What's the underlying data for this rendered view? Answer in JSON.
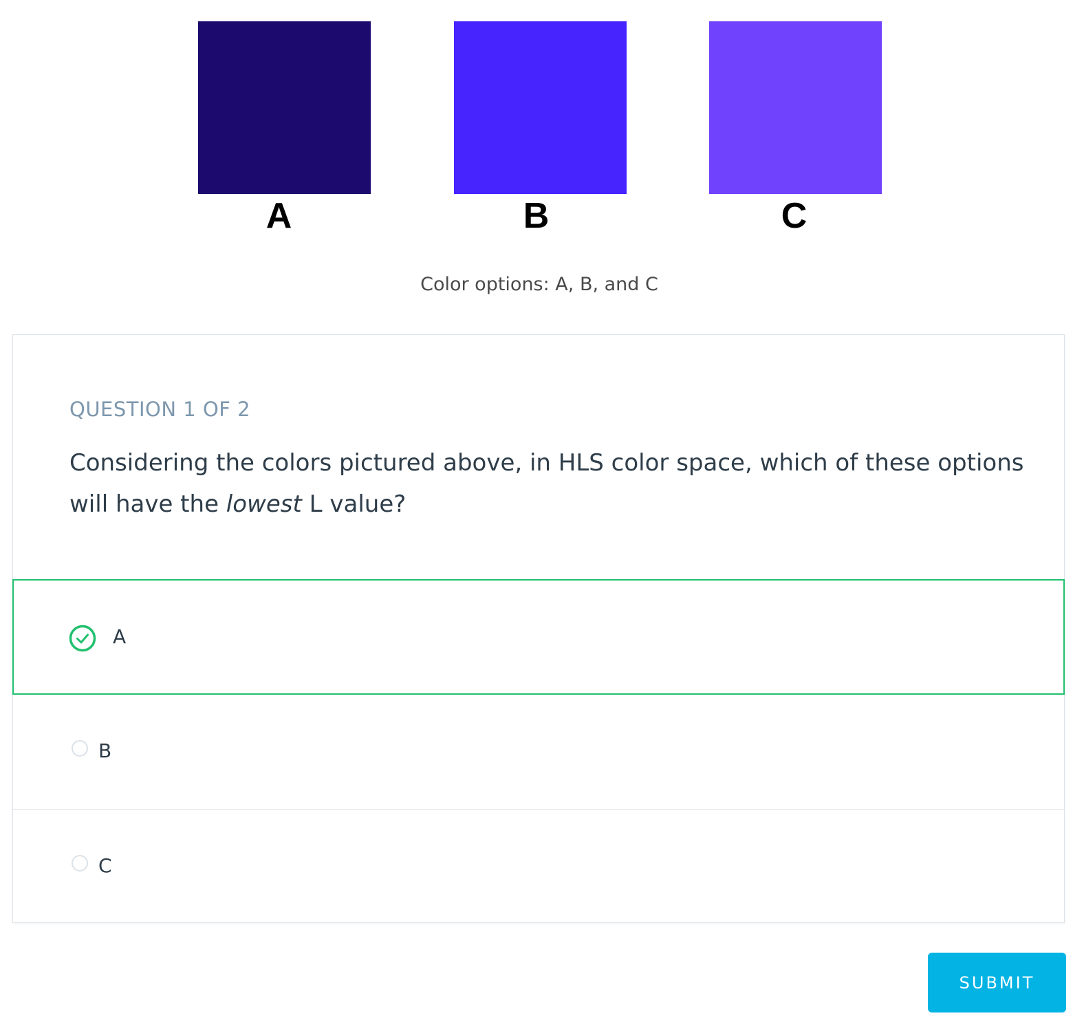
{
  "figure": {
    "swatches": [
      {
        "label": "A",
        "color": "#1d0a6e"
      },
      {
        "label": "B",
        "color": "#4723fe"
      },
      {
        "label": "C",
        "color": "#7142fd"
      }
    ],
    "caption": "Color options: A, B, and C"
  },
  "question": {
    "progress": "QUESTION 1 OF 2",
    "text_before": "Considering the colors pictured above, in HLS color space, which of these options will have the ",
    "text_emphasis": "lowest",
    "text_after": " L value?"
  },
  "options": [
    {
      "label": "A",
      "selected": true
    },
    {
      "label": "B",
      "selected": false
    },
    {
      "label": "C",
      "selected": false
    }
  ],
  "submit_label": "SUBMIT",
  "colors": {
    "selected_border": "#21c06e",
    "submit_bg": "#02b3e4",
    "progress_text": "#7d97ad"
  }
}
